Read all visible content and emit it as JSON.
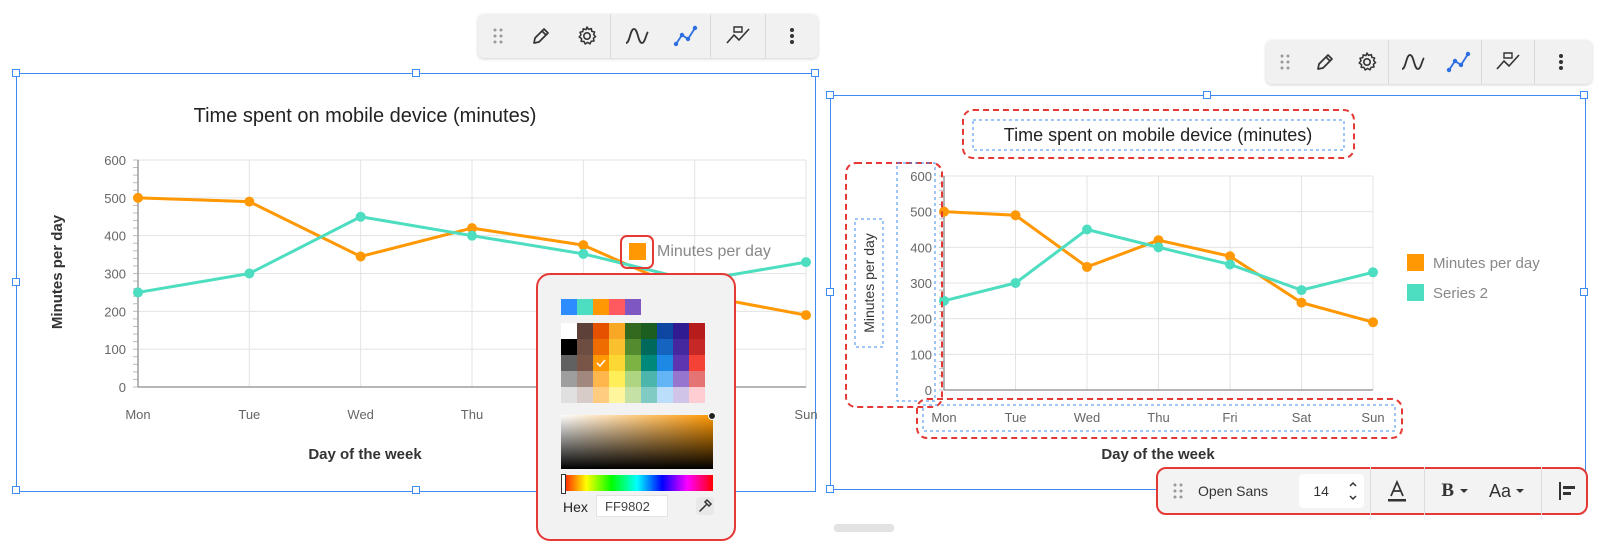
{
  "chart_data": [
    {
      "type": "line",
      "title": "Time spent on mobile device (minutes)",
      "xlabel": "Day of the week",
      "ylabel": "Minutes per day",
      "categories": [
        "Mon",
        "Tue",
        "Wed",
        "Thu",
        "Fri",
        "Sat",
        "Sun"
      ],
      "ylim": [
        0,
        600
      ],
      "yticks": [
        0,
        100,
        200,
        300,
        400,
        500,
        600
      ],
      "grid": true,
      "legend": "right",
      "series": [
        {
          "name": "Minutes per day",
          "color": "#FF9802",
          "values": [
            500,
            490,
            345,
            420,
            375,
            245,
            190
          ]
        },
        {
          "name": "",
          "color": "#4DDDC0",
          "values": [
            250,
            300,
            450,
            400,
            352,
            280,
            330
          ]
        }
      ]
    },
    {
      "type": "line",
      "title": "Time spent on mobile device (minutes)",
      "xlabel": "Day of the week",
      "ylabel": "Minutes per day",
      "categories": [
        "Mon",
        "Tue",
        "Wed",
        "Thu",
        "Fri",
        "Sat",
        "Sun"
      ],
      "ylim": [
        0,
        600
      ],
      "yticks": [
        0,
        100,
        200,
        300,
        400,
        500,
        600
      ],
      "grid": true,
      "legend": "right",
      "series": [
        {
          "name": "Minutes per day",
          "color": "#FF9802",
          "values": [
            500,
            490,
            345,
            420,
            375,
            245,
            190
          ]
        },
        {
          "name": "Series 2",
          "color": "#4DDDC0",
          "values": [
            250,
            300,
            450,
            400,
            352,
            280,
            330
          ]
        }
      ]
    }
  ],
  "color_picker": {
    "hex_label": "Hex",
    "hex_value": "FF9802",
    "recent_colors": [
      "#2D8CFF",
      "#4DDDC0",
      "#FF9802",
      "#FF5A5F",
      "#7E57C2"
    ],
    "palette": [
      [
        "#FFFFFF",
        "#5D4037",
        "#E65100",
        "#F9A825",
        "#33691E",
        "#1B5E20",
        "#0D47A1",
        "#311B92",
        "#B71C1C"
      ],
      [
        "#000000",
        "#6D4C41",
        "#EF6C00",
        "#FBC02D",
        "#558B2F",
        "#00695C",
        "#1565C0",
        "#4527A0",
        "#C62828"
      ],
      [
        "#616161",
        "#795548",
        "#FF9802",
        "#FDD835",
        "#7CB342",
        "#00897B",
        "#1E88E5",
        "#5E35B1",
        "#F44336"
      ],
      [
        "#9E9E9E",
        "#A1887F",
        "#FFB74D",
        "#FFEE58",
        "#AED581",
        "#4DB6AC",
        "#64B5F6",
        "#9575CD",
        "#E57373"
      ],
      [
        "#E0E0E0",
        "#D7CCC8",
        "#FFCC80",
        "#FFF59D",
        "#C5E1A5",
        "#80CBC4",
        "#BBDEFB",
        "#D1C4E9",
        "#FFCDD2"
      ]
    ],
    "selected_color": "#FF9802"
  },
  "format_bar": {
    "font_name": "Open Sans",
    "font_size": "14",
    "bold_label": "B",
    "case_label": "Aa"
  },
  "toolbar_icons": [
    "drag-handle-icon",
    "pencil-icon",
    "gear-icon",
    "smooth-curve-icon",
    "line-chart-icon",
    "data-point-icon",
    "more-vertical-icon"
  ]
}
